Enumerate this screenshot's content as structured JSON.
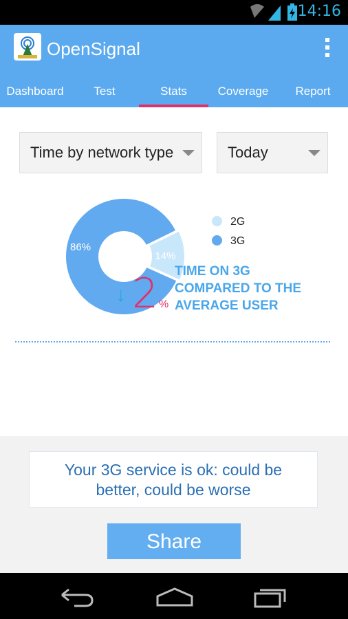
{
  "status_bar": {
    "time": "14:16"
  },
  "app": {
    "title": "OpenSignal"
  },
  "tabs": [
    {
      "label": "Dashboard"
    },
    {
      "label": "Test"
    },
    {
      "label": "Stats",
      "active": true
    },
    {
      "label": "Coverage"
    },
    {
      "label": "Report"
    }
  ],
  "filters": {
    "metric": "Time by network type",
    "period": "Today"
  },
  "chart_data": {
    "type": "pie",
    "title": "",
    "slices": [
      {
        "name": "2G",
        "value": 14,
        "label": "14%",
        "color": "#c9e7fb"
      },
      {
        "name": "3G",
        "value": 86,
        "label": "86%",
        "color": "#61aaef"
      }
    ]
  },
  "legend": [
    {
      "label": "2G",
      "color": "#c9e7fb"
    },
    {
      "label": "3G",
      "color": "#61aaef"
    }
  ],
  "comparison": {
    "direction": "down",
    "arrow": "↓",
    "value": "2",
    "unit": "%",
    "line1": "TIME ON 3G",
    "line2": "COMPARED TO THE",
    "line3": "AVERAGE USER"
  },
  "message": {
    "line1": "Your 3G service is ok: could be",
    "line2": "better, could be worse"
  },
  "share_label": "Share",
  "colors": {
    "accent": "#5baaf0",
    "highlight": "#e0306e",
    "arrow": "#2aa8e0"
  }
}
